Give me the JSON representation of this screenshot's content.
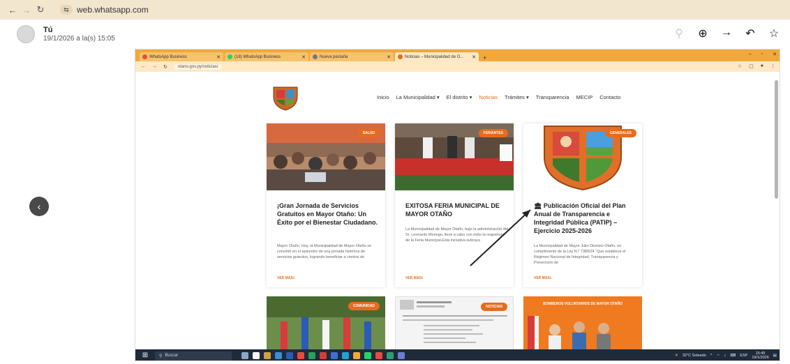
{
  "browser": {
    "url": "web.whatsapp.com",
    "back_icon": "arrow-left-icon",
    "forward_icon": "arrow-right-icon",
    "reload_icon": "reload-icon"
  },
  "viewer": {
    "sender": "Tú",
    "timestamp": "19/1/2026 a la(s) 15:05"
  },
  "shot": {
    "tabs": [
      {
        "label": "WhatsApp Business",
        "color": "#e84b3c"
      },
      {
        "label": "(18) WhatsApp Business",
        "color": "#25d366"
      },
      {
        "label": "Nueva pestaña",
        "color": "#777777"
      },
      {
        "label": "Noticias – Municipalidad de O...",
        "color": "#e76b1c"
      }
    ],
    "url": "otano.gov.py/noticias/",
    "nav": [
      "Inicio",
      "La Municipalidad ▾",
      "El distrito ▾",
      "Noticias",
      "Trámites ▾",
      "Transparencia",
      "MECIP",
      "Contacto"
    ],
    "nav_active_index": 3,
    "cards": [
      {
        "badge": "SALUD",
        "title": "¡Gran Jornada de Servicios Gratuitos en Mayor Otaño: Un Éxito por el Bienestar Ciudadano.",
        "excerpt": "Mayor Otaño, Hoy, la Municipalidad de Mayor Otaño se convirtió en el epicentro de una jornada histórica de servicios gratuitos, logrando beneficiar a cientos de",
        "more": "VER MAS»"
      },
      {
        "badge": "FERIANTES",
        "title": "EXITOSA FERIA MUNICIPAL DE MAYOR OTAÑO",
        "excerpt": "La Municipalidad de Mayor Otaño, bajo la administración del Sr. Leonardo Moringo, llevó a cabo con éxito la reapertura de la Feria Municipal.Esta iniciativa subraya",
        "more": "VER MAS»"
      },
      {
        "badge": "GENERALES",
        "title": "🏛 Publicación Oficial del Plan Anual de Transparencia e Integridad Pública (PATIP) – Ejercicio 2025-2026",
        "excerpt": "La Municipalidad de Mayor Julio Dionisio Otaño, en cumplimiento de la Ley N.º 7389/24 “Que establece el Régimen Nacional de Integridad, Transparencia y Prevención de",
        "more": "VER MAS»"
      }
    ],
    "row2_badges": [
      "COMUNIDAD",
      "NOTICIAS"
    ],
    "row2_banner": "BOMBEROS VOLUNTARIOS DE MAYOR OTAÑO",
    "taskbar": {
      "search": "Buscar",
      "weather": "32°C Soleado",
      "lang": "ESP",
      "time": "15:45",
      "date": "19/1/2026"
    }
  }
}
